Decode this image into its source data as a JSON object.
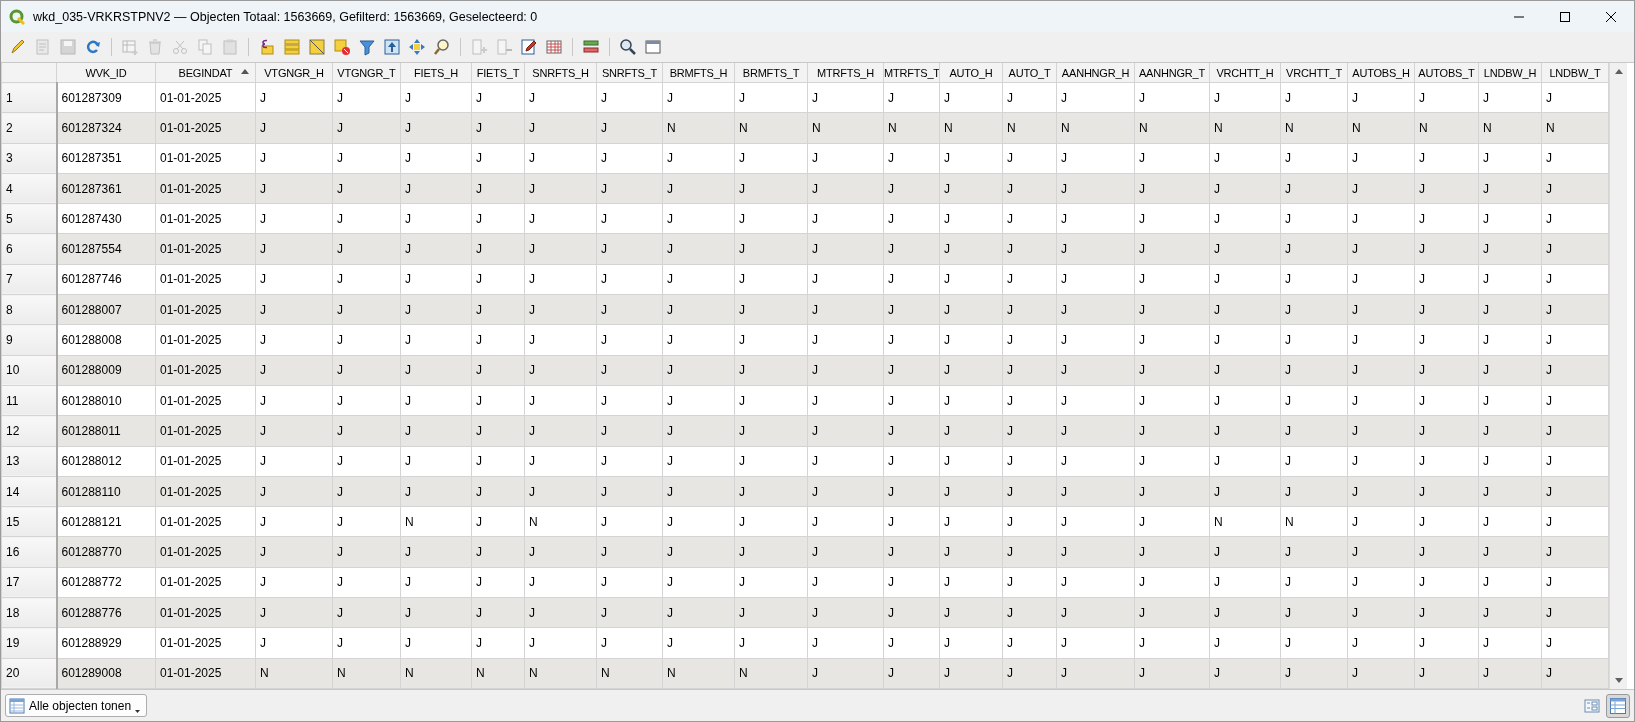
{
  "window": {
    "title": "wkd_035-VRKRSTPNV2 — Objecten Totaal: 1563669, Gefilterd: 1563669, Geselecteerd: 0"
  },
  "toolbar": [
    {
      "kind": "pencil",
      "disabled": false
    },
    {
      "kind": "notepad",
      "disabled": true
    },
    {
      "kind": "floppy",
      "disabled": true
    },
    {
      "kind": "refresh",
      "disabled": false
    },
    {
      "kind": "separator"
    },
    {
      "kind": "table-plus",
      "disabled": true
    },
    {
      "kind": "trash",
      "disabled": true
    },
    {
      "kind": "scissors",
      "disabled": true
    },
    {
      "kind": "copy",
      "disabled": true
    },
    {
      "kind": "clipboard",
      "disabled": true
    },
    {
      "kind": "separator"
    },
    {
      "kind": "epsilon",
      "disabled": false
    },
    {
      "kind": "bars",
      "disabled": false
    },
    {
      "kind": "triangle-square",
      "disabled": false
    },
    {
      "kind": "square-x",
      "disabled": false
    },
    {
      "kind": "funnel",
      "disabled": false
    },
    {
      "kind": "arrow-doc",
      "disabled": false
    },
    {
      "kind": "arrows-cross",
      "disabled": false
    },
    {
      "kind": "magnifier",
      "disabled": false
    },
    {
      "kind": "separator"
    },
    {
      "kind": "column-plus",
      "disabled": true
    },
    {
      "kind": "column-minus",
      "disabled": true
    },
    {
      "kind": "pencil-doc",
      "disabled": false
    },
    {
      "kind": "grid",
      "disabled": false
    },
    {
      "kind": "separator"
    },
    {
      "kind": "rows",
      "disabled": false
    },
    {
      "kind": "separator"
    },
    {
      "kind": "magnifier-gear",
      "disabled": false
    },
    {
      "kind": "window",
      "disabled": false
    }
  ],
  "table": {
    "columns": [
      {
        "label": "WVK_ID",
        "sorted": false
      },
      {
        "label": "BEGINDAT",
        "sorted": true
      },
      {
        "label": "VTGNGR_H",
        "sorted": false
      },
      {
        "label": "VTGNGR_T",
        "sorted": false
      },
      {
        "label": "FIETS_H",
        "sorted": false
      },
      {
        "label": "FIETS_T",
        "sorted": false
      },
      {
        "label": "SNRFTS_H",
        "sorted": false
      },
      {
        "label": "SNRFTS_T",
        "sorted": false
      },
      {
        "label": "BRMFTS_H",
        "sorted": false
      },
      {
        "label": "BRMFTS_T",
        "sorted": false
      },
      {
        "label": "MTRFTS_H",
        "sorted": false
      },
      {
        "label": "MTRFTS_T",
        "sorted": false
      },
      {
        "label": "AUTO_H",
        "sorted": false
      },
      {
        "label": "AUTO_T",
        "sorted": false
      },
      {
        "label": "AANHNGR_H",
        "sorted": false
      },
      {
        "label": "AANHNGR_T",
        "sorted": false
      },
      {
        "label": "VRCHTT_H",
        "sorted": false
      },
      {
        "label": "VRCHTT_T",
        "sorted": false
      },
      {
        "label": "AUTOBS_H",
        "sorted": false
      },
      {
        "label": "AUTOBS_T",
        "sorted": false
      },
      {
        "label": "LNDBW_H",
        "sorted": false
      },
      {
        "label": "LNDBW_T",
        "sorted": false
      }
    ],
    "rows": [
      {
        "number": "1",
        "cells": [
          "601287309",
          "01-01-2025",
          "J",
          "J",
          "J",
          "J",
          "J",
          "J",
          "J",
          "J",
          "J",
          "J",
          "J",
          "J",
          "J",
          "J",
          "J",
          "J",
          "J",
          "J",
          "J",
          "J"
        ]
      },
      {
        "number": "2",
        "cells": [
          "601287324",
          "01-01-2025",
          "J",
          "J",
          "J",
          "J",
          "J",
          "J",
          "N",
          "N",
          "N",
          "N",
          "N",
          "N",
          "N",
          "N",
          "N",
          "N",
          "N",
          "N",
          "N",
          "N"
        ]
      },
      {
        "number": "3",
        "cells": [
          "601287351",
          "01-01-2025",
          "J",
          "J",
          "J",
          "J",
          "J",
          "J",
          "J",
          "J",
          "J",
          "J",
          "J",
          "J",
          "J",
          "J",
          "J",
          "J",
          "J",
          "J",
          "J",
          "J"
        ]
      },
      {
        "number": "4",
        "cells": [
          "601287361",
          "01-01-2025",
          "J",
          "J",
          "J",
          "J",
          "J",
          "J",
          "J",
          "J",
          "J",
          "J",
          "J",
          "J",
          "J",
          "J",
          "J",
          "J",
          "J",
          "J",
          "J",
          "J"
        ]
      },
      {
        "number": "5",
        "cells": [
          "601287430",
          "01-01-2025",
          "J",
          "J",
          "J",
          "J",
          "J",
          "J",
          "J",
          "J",
          "J",
          "J",
          "J",
          "J",
          "J",
          "J",
          "J",
          "J",
          "J",
          "J",
          "J",
          "J"
        ]
      },
      {
        "number": "6",
        "cells": [
          "601287554",
          "01-01-2025",
          "J",
          "J",
          "J",
          "J",
          "J",
          "J",
          "J",
          "J",
          "J",
          "J",
          "J",
          "J",
          "J",
          "J",
          "J",
          "J",
          "J",
          "J",
          "J",
          "J"
        ]
      },
      {
        "number": "7",
        "cells": [
          "601287746",
          "01-01-2025",
          "J",
          "J",
          "J",
          "J",
          "J",
          "J",
          "J",
          "J",
          "J",
          "J",
          "J",
          "J",
          "J",
          "J",
          "J",
          "J",
          "J",
          "J",
          "J",
          "J"
        ]
      },
      {
        "number": "8",
        "cells": [
          "601288007",
          "01-01-2025",
          "J",
          "J",
          "J",
          "J",
          "J",
          "J",
          "J",
          "J",
          "J",
          "J",
          "J",
          "J",
          "J",
          "J",
          "J",
          "J",
          "J",
          "J",
          "J",
          "J"
        ]
      },
      {
        "number": "9",
        "cells": [
          "601288008",
          "01-01-2025",
          "J",
          "J",
          "J",
          "J",
          "J",
          "J",
          "J",
          "J",
          "J",
          "J",
          "J",
          "J",
          "J",
          "J",
          "J",
          "J",
          "J",
          "J",
          "J",
          "J"
        ]
      },
      {
        "number": "10",
        "cells": [
          "601288009",
          "01-01-2025",
          "J",
          "J",
          "J",
          "J",
          "J",
          "J",
          "J",
          "J",
          "J",
          "J",
          "J",
          "J",
          "J",
          "J",
          "J",
          "J",
          "J",
          "J",
          "J",
          "J"
        ]
      },
      {
        "number": "11",
        "cells": [
          "601288010",
          "01-01-2025",
          "J",
          "J",
          "J",
          "J",
          "J",
          "J",
          "J",
          "J",
          "J",
          "J",
          "J",
          "J",
          "J",
          "J",
          "J",
          "J",
          "J",
          "J",
          "J",
          "J"
        ]
      },
      {
        "number": "12",
        "cells": [
          "601288011",
          "01-01-2025",
          "J",
          "J",
          "J",
          "J",
          "J",
          "J",
          "J",
          "J",
          "J",
          "J",
          "J",
          "J",
          "J",
          "J",
          "J",
          "J",
          "J",
          "J",
          "J",
          "J"
        ]
      },
      {
        "number": "13",
        "cells": [
          "601288012",
          "01-01-2025",
          "J",
          "J",
          "J",
          "J",
          "J",
          "J",
          "J",
          "J",
          "J",
          "J",
          "J",
          "J",
          "J",
          "J",
          "J",
          "J",
          "J",
          "J",
          "J",
          "J"
        ]
      },
      {
        "number": "14",
        "cells": [
          "601288110",
          "01-01-2025",
          "J",
          "J",
          "J",
          "J",
          "J",
          "J",
          "J",
          "J",
          "J",
          "J",
          "J",
          "J",
          "J",
          "J",
          "J",
          "J",
          "J",
          "J",
          "J",
          "J"
        ]
      },
      {
        "number": "15",
        "cells": [
          "601288121",
          "01-01-2025",
          "J",
          "J",
          "N",
          "J",
          "N",
          "J",
          "J",
          "J",
          "J",
          "J",
          "J",
          "J",
          "J",
          "J",
          "N",
          "N",
          "J",
          "J",
          "J",
          "J"
        ]
      },
      {
        "number": "16",
        "cells": [
          "601288770",
          "01-01-2025",
          "J",
          "J",
          "J",
          "J",
          "J",
          "J",
          "J",
          "J",
          "J",
          "J",
          "J",
          "J",
          "J",
          "J",
          "J",
          "J",
          "J",
          "J",
          "J",
          "J"
        ]
      },
      {
        "number": "17",
        "cells": [
          "601288772",
          "01-01-2025",
          "J",
          "J",
          "J",
          "J",
          "J",
          "J",
          "J",
          "J",
          "J",
          "J",
          "J",
          "J",
          "J",
          "J",
          "J",
          "J",
          "J",
          "J",
          "J",
          "J"
        ]
      },
      {
        "number": "18",
        "cells": [
          "601288776",
          "01-01-2025",
          "J",
          "J",
          "J",
          "J",
          "J",
          "J",
          "J",
          "J",
          "J",
          "J",
          "J",
          "J",
          "J",
          "J",
          "J",
          "J",
          "J",
          "J",
          "J",
          "J"
        ]
      },
      {
        "number": "19",
        "cells": [
          "601288929",
          "01-01-2025",
          "J",
          "J",
          "J",
          "J",
          "J",
          "J",
          "J",
          "J",
          "J",
          "J",
          "J",
          "J",
          "J",
          "J",
          "J",
          "J",
          "J",
          "J",
          "J",
          "J"
        ]
      },
      {
        "number": "20",
        "cells": [
          "601289008",
          "01-01-2025",
          "N",
          "N",
          "N",
          "N",
          "N",
          "N",
          "N",
          "N",
          "J",
          "J",
          "J",
          "J",
          "J",
          "J",
          "J",
          "J",
          "J",
          "J",
          "J",
          "J"
        ]
      }
    ]
  },
  "footer": {
    "filter_button": "Alle objecten tonen",
    "views": [
      {
        "kind": "form",
        "selected": false
      },
      {
        "kind": "table",
        "selected": true
      }
    ]
  }
}
